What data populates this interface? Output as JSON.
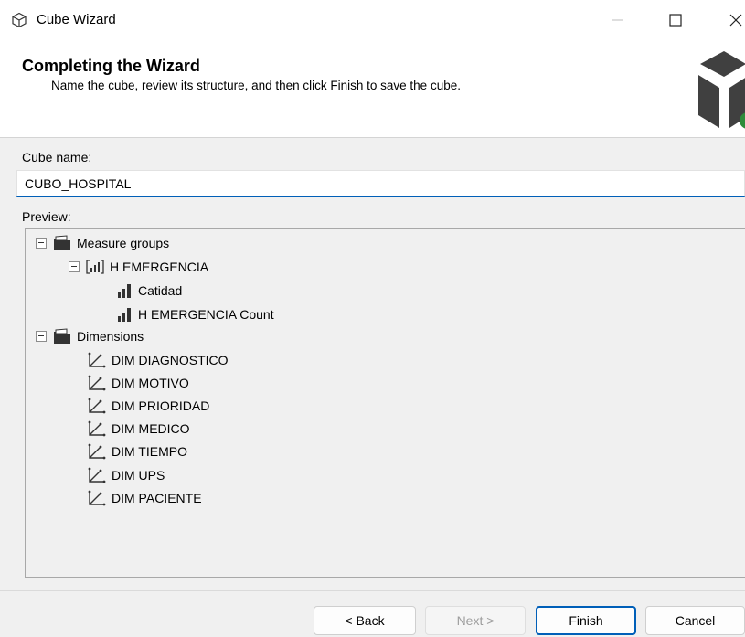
{
  "window": {
    "title": "Cube Wizard",
    "icon": "cube-outline-icon",
    "controls": {
      "minimize": "—",
      "maximize": "☐",
      "close": "✕"
    }
  },
  "header": {
    "title": "Completing the Wizard",
    "subtitle": "Name the cube, review its structure, and then click Finish to save the cube."
  },
  "form": {
    "cube_name_label": "Cube name:",
    "cube_name_value": "CUBO_HOSPITAL",
    "preview_label": "Preview:"
  },
  "tree": {
    "measure_groups": {
      "label": "Measure groups",
      "group": {
        "label": "H EMERGENCIA",
        "measures": [
          "Catidad",
          "H EMERGENCIA Count"
        ]
      }
    },
    "dimensions": {
      "label": "Dimensions",
      "items": [
        "DIM DIAGNOSTICO",
        "DIM MOTIVO",
        "DIM PRIORIDAD",
        "DIM MEDICO",
        "DIM TIEMPO",
        "DIM UPS",
        "DIM PACIENTE"
      ]
    }
  },
  "buttons": {
    "back": "< Back",
    "next": "Next >",
    "finish": "Finish",
    "cancel": "Cancel"
  },
  "colors": {
    "accent": "#005fb8",
    "logo_dark": "#404040",
    "logo_accent": "#2e8b3a"
  }
}
